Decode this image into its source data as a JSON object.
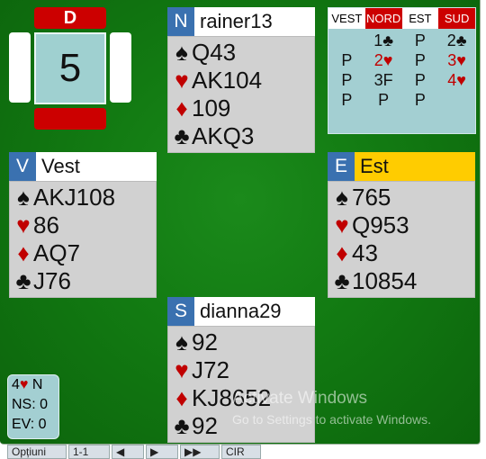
{
  "board": {
    "dealer": "D",
    "number": "5"
  },
  "north": {
    "pos": "N",
    "name": "rainer13",
    "spades": "Q43",
    "hearts": "AK104",
    "diamonds": "109",
    "clubs": "AKQ3"
  },
  "west": {
    "pos": "V",
    "name": "Vest",
    "spades": "AKJ108",
    "hearts": "86",
    "diamonds": "AQ7",
    "clubs": "J76"
  },
  "east": {
    "pos": "E",
    "name": "Est",
    "spades": "765",
    "hearts": "Q953",
    "diamonds": "43",
    "clubs": "10854"
  },
  "south": {
    "pos": "S",
    "name": "dianna29",
    "spades": "92",
    "hearts": "J72",
    "diamonds": "KJ8652",
    "clubs": "92"
  },
  "bidding": {
    "headers": [
      "VEST",
      "NORD",
      "EST",
      "SUD"
    ],
    "rows": [
      [
        "",
        "1♣",
        "P",
        "2♣"
      ],
      [
        "P",
        "2♥",
        "P",
        "3♥"
      ],
      [
        "P",
        "3F",
        "P",
        "4♥"
      ],
      [
        "P",
        "P",
        "P",
        ""
      ]
    ]
  },
  "score": {
    "contract_level": "4",
    "contract_suit": "♥",
    "declarer": "N",
    "ns": "NS: 0",
    "ev": "EV: 0"
  },
  "symbols": {
    "spade": "♠",
    "heart": "♥",
    "diamond": "♦",
    "club": "♣"
  },
  "watermark": {
    "line1": "Activate Windows",
    "line2": "Go to Settings to activate Windows."
  },
  "toolbar": [
    "Opțiuni",
    "1-1",
    "◀",
    "▶",
    "▶▶",
    "CIR"
  ],
  "colors": {
    "felt": "#127a12",
    "seat": "#3a71b0",
    "east_header": "#ffcc00",
    "red": "#cc0000"
  }
}
